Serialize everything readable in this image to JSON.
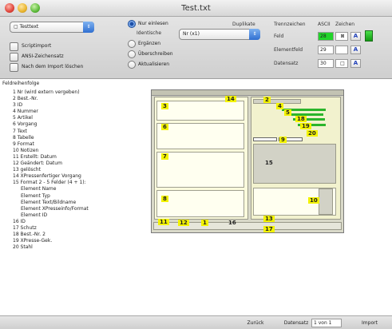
{
  "window": {
    "title": "Test.txt"
  },
  "toolbar": {
    "file_popup": "Testtext",
    "checkboxes": [
      "Scriptimport",
      "ANSI-Zeichensatz",
      "Nach dem Import löschen"
    ],
    "radio_top": "Nur einlesen",
    "identical_label": "Identische",
    "identical_popup": "Nr (x1)",
    "radios": [
      "Ergänzen",
      "Überschreiben",
      "Aktualisieren"
    ],
    "duplicates_label": "Duplikate",
    "separator_header": "Trennzeichen",
    "ascii_header": "ASCII",
    "char_header": "Zeichen",
    "rows": [
      {
        "label": "Feld",
        "ascii": "28",
        "char": "⊠"
      },
      {
        "label": "Elementfeld",
        "ascii": "29",
        "char": ""
      },
      {
        "label": "Datensatz",
        "ascii": "30",
        "char": "□"
      }
    ],
    "mini_btn": "A"
  },
  "sequence": {
    "title": "Feldreihenfolge",
    "items": [
      "1 Nr (wird extern vergeben)",
      "2 Best.-Nr.",
      "3 ID",
      "4 Nummer",
      "5 Artikel",
      "6 Vorgang",
      "7 Text",
      "8 Tabelle",
      "9 Format",
      "10 Notizen",
      "11 Erstellt: Datum",
      "12 Geändert: Datum",
      "13 gelöscht",
      "14 XPressenfertiger Vorgang",
      "15 Format 2 - 5 Felder (4 + 1):",
      "Element Name",
      "Element Typ",
      "Element Text/Bildname",
      "Element XPresseinfo/Format",
      "Element ID",
      "16 ID",
      "17 Schutz",
      "18 Best.-Nr. 2",
      "19 XPresse-Gek.",
      "20 Stahl"
    ],
    "indented": [
      15,
      16,
      17,
      18,
      19
    ]
  },
  "preview": {
    "labels": [
      "3",
      "6",
      "7",
      "8",
      "11",
      "12",
      "1",
      "16",
      "14",
      "2",
      "4",
      "5",
      "18",
      "19",
      "20",
      "9",
      "15",
      "10",
      "13",
      "17"
    ]
  },
  "statusbar": {
    "back": "Zurück",
    "record_label": "Datensatz",
    "record_value": "1 von 1",
    "import": "Import"
  }
}
